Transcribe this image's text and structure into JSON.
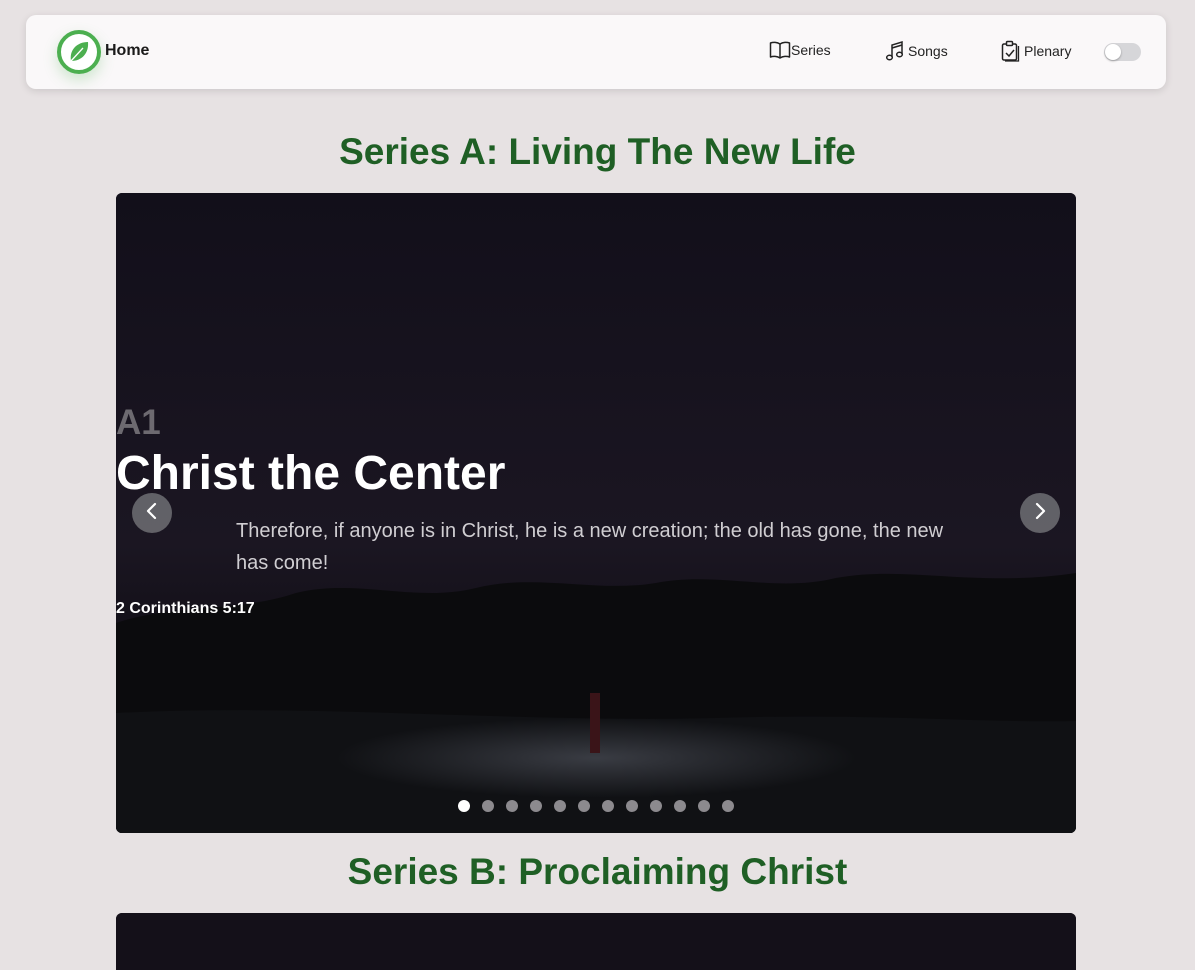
{
  "nav": {
    "brand_label": "Home",
    "links": [
      {
        "label": "Series",
        "icon": "book-icon"
      },
      {
        "label": "Songs",
        "icon": "music-note-icon"
      },
      {
        "label": "Plenary",
        "icon": "clipboard-check-icon"
      }
    ],
    "theme_toggle": {
      "state": "off"
    }
  },
  "colors": {
    "accent_green": "#1f5f25",
    "logo_green": "#4caf50",
    "page_bg": "#e7e2e3"
  },
  "series": [
    {
      "title": "Series A: Living The New Life",
      "active_slide": {
        "code": "A1",
        "title": "Christ the Center",
        "verse": "Therefore, if anyone is in Christ, he is a new creation; the old has gone, the new has come!",
        "reference": "2 Corinthians 5:17"
      },
      "slide_count": 12,
      "active_index": 0,
      "prev_icon": "chevron-left-icon",
      "next_icon": "chevron-right-icon"
    },
    {
      "title": "Series B: Proclaiming Christ"
    }
  ]
}
